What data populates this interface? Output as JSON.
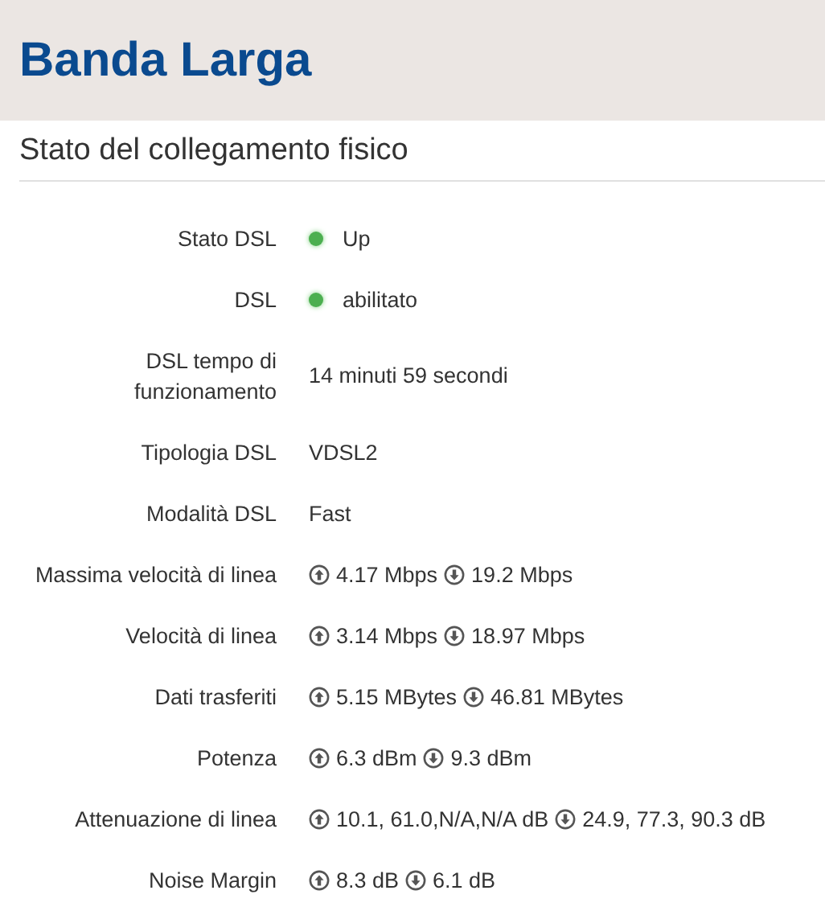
{
  "header": {
    "title": "Banda Larga"
  },
  "section": {
    "title": "Stato del collegamento fisico"
  },
  "rows": [
    {
      "kind": "status",
      "label": "Stato DSL",
      "color": "#4caf50",
      "value": "Up"
    },
    {
      "kind": "status",
      "label": "DSL",
      "color": "#4caf50",
      "value": "abilitato"
    },
    {
      "kind": "text",
      "label": "DSL tempo di funzionamento",
      "value": "14 minuti 59 secondi"
    },
    {
      "kind": "text",
      "label": "Tipologia DSL",
      "value": "VDSL2"
    },
    {
      "kind": "text",
      "label": "Modalità DSL",
      "value": "Fast"
    },
    {
      "kind": "updown",
      "label": "Massima velocità di linea",
      "up": "4.17 Mbps",
      "down": "19.2 Mbps"
    },
    {
      "kind": "updown",
      "label": "Velocità di linea",
      "up": "3.14 Mbps",
      "down": "18.97 Mbps"
    },
    {
      "kind": "updown",
      "label": "Dati trasferiti",
      "up": "5.15 MBytes",
      "down": "46.81 MBytes"
    },
    {
      "kind": "updown",
      "label": "Potenza",
      "up": "6.3 dBm",
      "down": "9.3 dBm"
    },
    {
      "kind": "updown",
      "label": "Attenuazione di linea",
      "up": "10.1, 61.0,N/A,N/A dB",
      "down": "24.9, 77.3, 90.3 dB"
    },
    {
      "kind": "updown",
      "label": "Noise Margin",
      "up": "8.3 dB",
      "down": "6.1 dB"
    }
  ]
}
